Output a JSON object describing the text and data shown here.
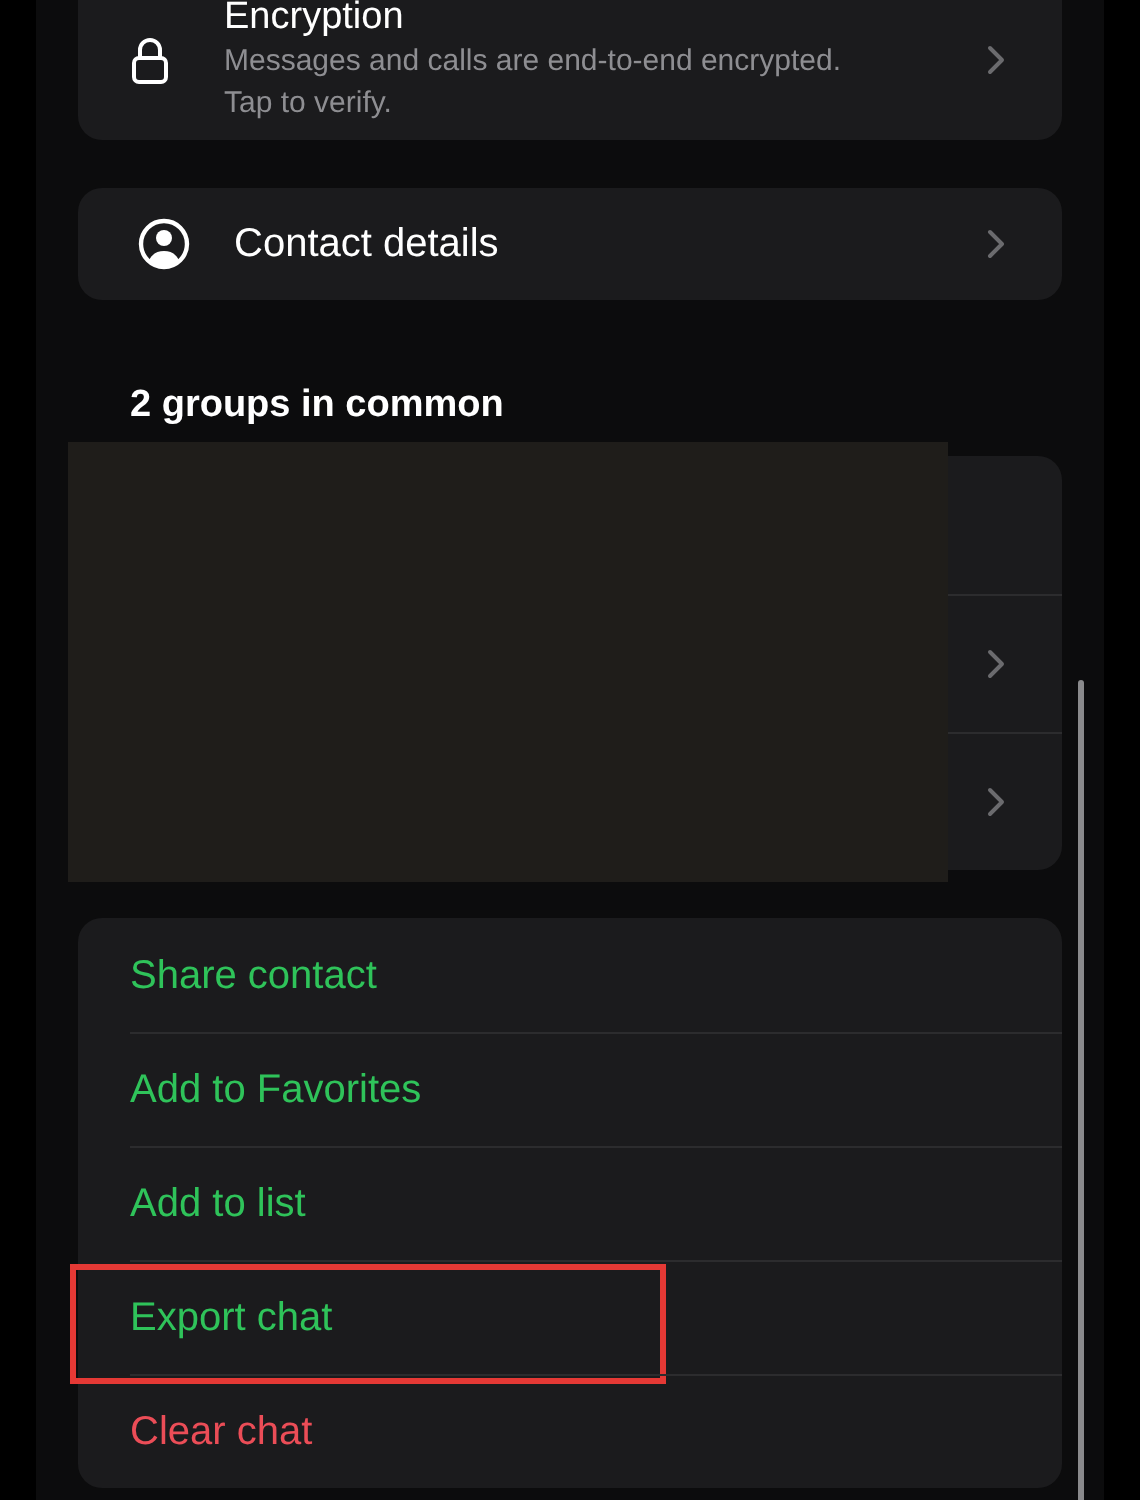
{
  "encryption": {
    "title": "Encryption",
    "subtitle": "Messages and calls are end-to-end encrypted. Tap to verify."
  },
  "contact_details": {
    "label": "Contact details"
  },
  "groups": {
    "heading": "2 groups in common",
    "rows": [
      {
        "chevron": false
      },
      {
        "chevron": true
      },
      {
        "chevron": true
      }
    ],
    "redacted": true
  },
  "actions": [
    {
      "label": "Share contact",
      "kind": "normal",
      "highlighted": false
    },
    {
      "label": "Add to Favorites",
      "kind": "normal",
      "highlighted": false
    },
    {
      "label": "Add to list",
      "kind": "normal",
      "highlighted": false
    },
    {
      "label": "Export chat",
      "kind": "normal",
      "highlighted": true
    },
    {
      "label": "Clear chat",
      "kind": "destructive",
      "highlighted": false
    }
  ]
}
